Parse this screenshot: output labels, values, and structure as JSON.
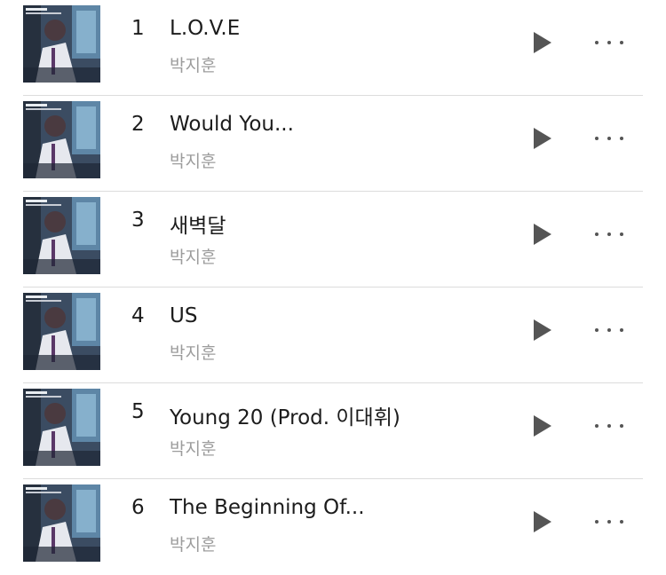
{
  "colors": {
    "title_text": "#1c1c1c",
    "artist_text": "#9c9c9c",
    "icon": "#555555",
    "divider": "#dcdcdc",
    "background": "#ffffff"
  },
  "icons": {
    "play": "play-icon",
    "more": "more-options-icon"
  },
  "tracks": [
    {
      "number": "1",
      "title": "L.O.V.E",
      "artist": "박지훈"
    },
    {
      "number": "2",
      "title": "Would You...",
      "artist": "박지훈"
    },
    {
      "number": "3",
      "title": "새벽달",
      "artist": "박지훈"
    },
    {
      "number": "4",
      "title": "US",
      "artist": "박지훈"
    },
    {
      "number": "5",
      "title": "Young 20 (Prod. 이대휘)",
      "artist": "박지훈"
    },
    {
      "number": "6",
      "title": "The Beginning Of...",
      "artist": "박지훈"
    }
  ]
}
